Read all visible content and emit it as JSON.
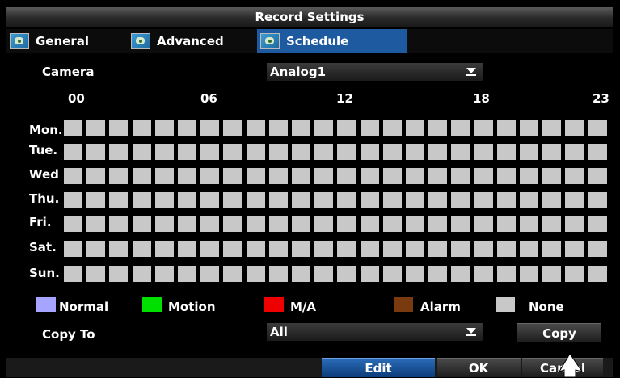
{
  "window": {
    "title": "Record Settings"
  },
  "tabs": [
    {
      "label": "General",
      "icon": "camera-settings-icon",
      "active": false
    },
    {
      "label": "Advanced",
      "icon": "camera-settings-icon",
      "active": false
    },
    {
      "label": "Schedule",
      "icon": "camera-settings-icon",
      "active": true
    }
  ],
  "camera": {
    "label": "Camera",
    "value": "Analog1"
  },
  "schedule": {
    "hour_labels": [
      "00",
      "06",
      "12",
      "18",
      "23"
    ],
    "days": [
      "Mon.",
      "Tue.",
      "Wed",
      "Thu.",
      "Fri.",
      "Sat.",
      "Sun."
    ],
    "slots_per_day": 24,
    "slot_state": "None"
  },
  "legend": [
    {
      "label": "Normal",
      "color": "#a5a5ff"
    },
    {
      "label": "Motion",
      "color": "#00e000"
    },
    {
      "label": "M/A",
      "color": "#ee0000"
    },
    {
      "label": "Alarm",
      "color": "#7a3a10"
    },
    {
      "label": "None",
      "color": "#c8c8c8"
    }
  ],
  "copy_to": {
    "label": "Copy To",
    "value": "All",
    "button": "Copy"
  },
  "buttons": {
    "edit": "Edit",
    "ok": "OK",
    "cancel": "Cancel"
  }
}
